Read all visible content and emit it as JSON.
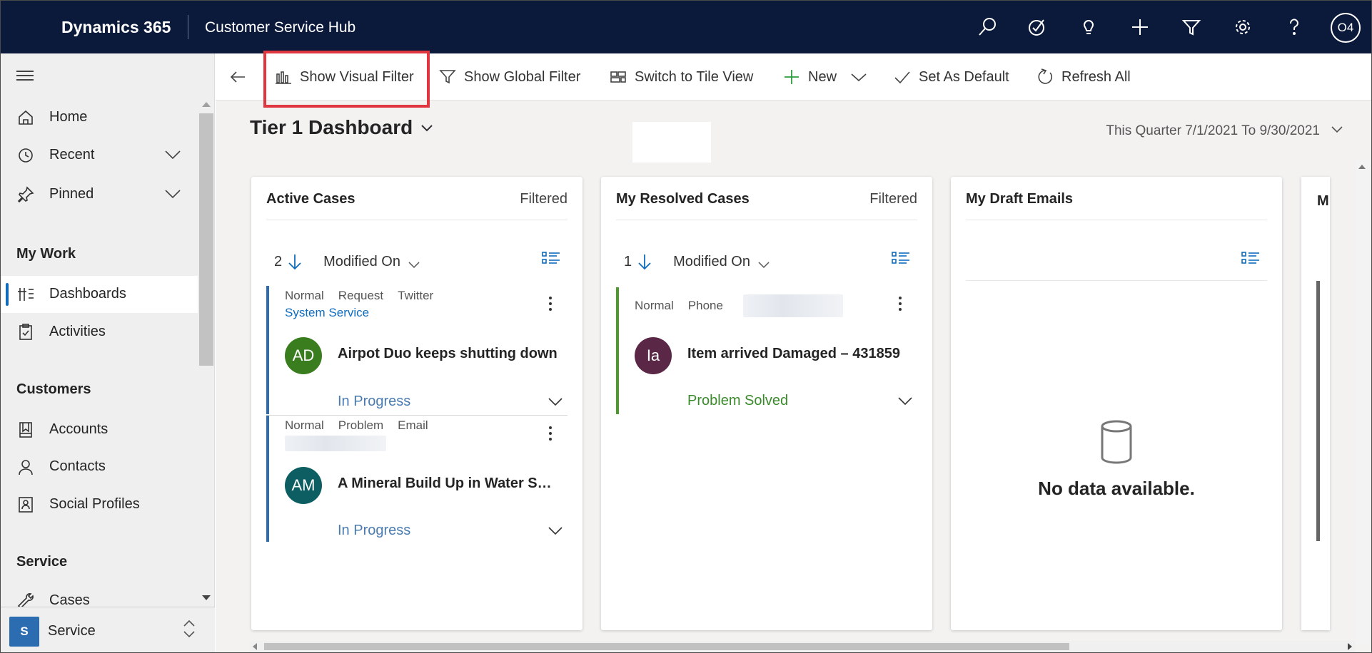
{
  "topbar": {
    "brand": "Dynamics 365",
    "app_name": "Customer Service Hub",
    "icons": [
      "search-icon",
      "assistant-icon",
      "lightbulb-icon",
      "plus-icon",
      "filter-icon",
      "settings-icon",
      "help-icon"
    ],
    "user_initials": "O4"
  },
  "sidebar": {
    "items": [
      {
        "label": "Home",
        "icon": "home-icon"
      },
      {
        "label": "Recent",
        "icon": "clock-icon"
      },
      {
        "label": "Pinned",
        "icon": "pin-icon"
      }
    ],
    "groups": [
      {
        "title": "My Work",
        "items": [
          {
            "label": "Dashboards",
            "icon": "dashboard-icon",
            "selected": true
          },
          {
            "label": "Activities",
            "icon": "clipboard-icon"
          }
        ]
      },
      {
        "title": "Customers",
        "items": [
          {
            "label": "Accounts",
            "icon": "accounts-icon"
          },
          {
            "label": "Contacts",
            "icon": "person-icon"
          },
          {
            "label": "Social Profiles",
            "icon": "social-profile-icon"
          }
        ]
      },
      {
        "title": "Service",
        "items": [
          {
            "label": "Cases",
            "icon": "wrench-icon"
          }
        ]
      }
    ],
    "area": {
      "badge": "S",
      "label": "Service"
    }
  },
  "commandbar": {
    "back_icon": "back-arrow-icon",
    "show_visual_filter": "Show Visual Filter",
    "show_global_filter": "Show Global Filter",
    "switch_tile_view": "Switch to Tile View",
    "new": "New",
    "set_default": "Set As Default",
    "refresh_all": "Refresh All"
  },
  "dashboard": {
    "title": "Tier 1 Dashboard",
    "period": "This Quarter 7/1/2021 To 9/30/2021"
  },
  "streams": [
    {
      "title": "Active Cases",
      "filtered": "Filtered",
      "count": "2",
      "sort_label": "Modified On",
      "cases": [
        {
          "priority": "Normal",
          "type": "Request",
          "origin": "Twitter",
          "owner": "System Service",
          "initials": "AD",
          "avatar_color": "#3a7d1f",
          "title": "Airpot Duo keeps shutting down",
          "status": "In Progress",
          "status_color": "#4a7bb0",
          "bar_color": "#2e6bb0"
        },
        {
          "priority": "Normal",
          "type": "Problem",
          "origin": "Email",
          "initials": "AM",
          "avatar_color": "#0d5e62",
          "title": "A Mineral Build Up in Water Supply",
          "status": "In Progress",
          "status_color": "#4a7bb0",
          "bar_color": "#2e6bb0"
        }
      ]
    },
    {
      "title": "My Resolved Cases",
      "filtered": "Filtered",
      "count": "1",
      "sort_label": "Modified On",
      "cases": [
        {
          "priority": "Normal",
          "type": "Phone",
          "initials": "Ia",
          "avatar_color": "#5a2747",
          "title": "Item arrived Damaged – 431859",
          "status": "Problem Solved",
          "status_color": "#3b8a2c",
          "bar_color": "#4a9a2c"
        }
      ]
    },
    {
      "title": "My Draft Emails",
      "empty_text": "No data available."
    }
  ],
  "next_card_peek": "M"
}
